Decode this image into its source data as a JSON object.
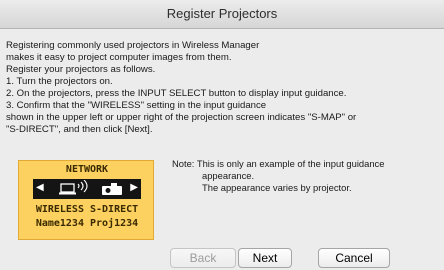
{
  "window": {
    "title": "Register Projectors"
  },
  "intro_lines": [
    "Registering commonly used projectors in Wireless Manager",
    "makes it easy to project computer images from them.",
    "Register your projectors as follows.",
    "1. Turn the projectors on.",
    "2. On the projectors, press the INPUT SELECT button to display input guidance.",
    "3. Confirm that the \"WIRELESS\" setting in the input guidance",
    "    shown in the upper left or upper right of the projection screen indicates \"S-MAP\" or",
    "\"S-DIRECT\", and then click [Next]."
  ],
  "guidance": {
    "title": "NETWORK",
    "line1": "WIRELESS S-DIRECT",
    "line2": "Name1234 Proj1234",
    "arrow_left": "◀",
    "arrow_right": "▶",
    "icons": [
      "laptop-wireless-icon",
      "projector-icon"
    ]
  },
  "note": {
    "line1": "Note: This is only an example of the input guidance",
    "line2": "appearance.",
    "line3": "The appearance varies by projector."
  },
  "buttons": {
    "back": "Back",
    "next": "Next",
    "cancel": "Cancel"
  },
  "colors": {
    "guidance_bg": "#fdd15f",
    "guidance_band": "#141414"
  }
}
